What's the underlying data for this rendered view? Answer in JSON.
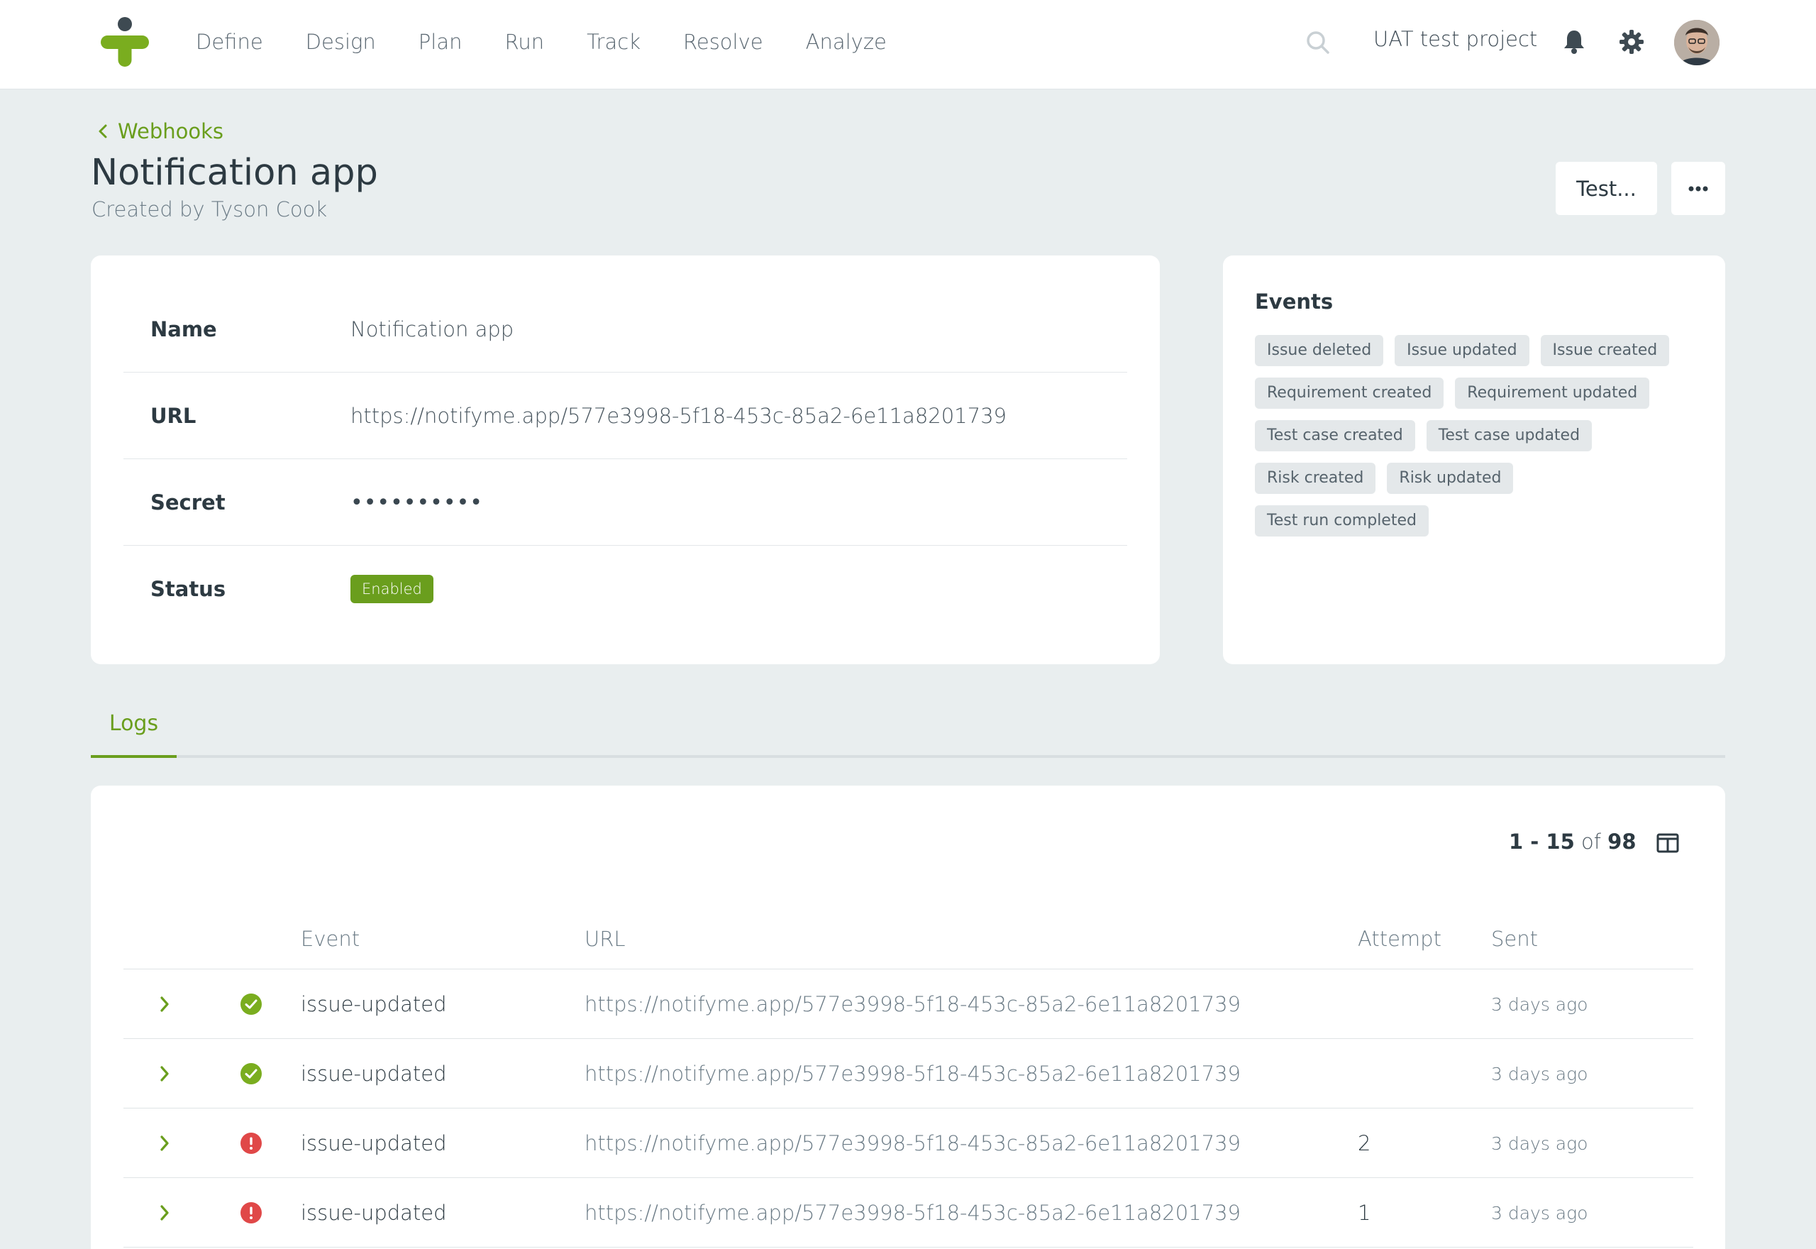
{
  "nav": {
    "items": [
      "Define",
      "Design",
      "Plan",
      "Run",
      "Track",
      "Resolve",
      "Analyze"
    ],
    "project_name": "UAT test project"
  },
  "header": {
    "back_label": "Webhooks",
    "title": "Notification app",
    "subtitle": "Created by Tyson Cook",
    "test_button": "Test...",
    "more_button": "•••"
  },
  "details": {
    "name_label": "Name",
    "name_value": "Notification app",
    "url_label": "URL",
    "url_value": "https://notifyme.app/577e3998-5f18-453c-85a2-6e11a8201739",
    "secret_label": "Secret",
    "secret_value": "••••••••••",
    "status_label": "Status",
    "status_value": "Enabled"
  },
  "events": {
    "title": "Events",
    "items": [
      "Issue deleted",
      "Issue updated",
      "Issue created",
      "Requirement created",
      "Requirement updated",
      "Test case created",
      "Test case updated",
      "Risk created",
      "Risk updated",
      "Test run completed"
    ]
  },
  "tabs": {
    "logs": "Logs"
  },
  "logs": {
    "pagination": {
      "range": "1 - 15",
      "of": "of",
      "total": "98"
    },
    "columns": {
      "event": "Event",
      "url": "URL",
      "attempt": "Attempt",
      "sent": "Sent"
    },
    "rows": [
      {
        "status": "success",
        "event": "issue-updated",
        "url": "https://notifyme.app/577e3998-5f18-453c-85a2-6e11a8201739",
        "attempt": "",
        "sent": "3 days ago"
      },
      {
        "status": "success",
        "event": "issue-updated",
        "url": "https://notifyme.app/577e3998-5f18-453c-85a2-6e11a8201739",
        "attempt": "",
        "sent": "3 days ago"
      },
      {
        "status": "error",
        "event": "issue-updated",
        "url": "https://notifyme.app/577e3998-5f18-453c-85a2-6e11a8201739",
        "attempt": "2",
        "sent": "3 days ago"
      },
      {
        "status": "error",
        "event": "issue-updated",
        "url": "https://notifyme.app/577e3998-5f18-453c-85a2-6e11a8201739",
        "attempt": "1",
        "sent": "3 days ago"
      }
    ]
  },
  "colors": {
    "accent": "#6a9e1d",
    "success": "#7aad1f",
    "error": "#e04848",
    "background": "#e9eeef"
  }
}
